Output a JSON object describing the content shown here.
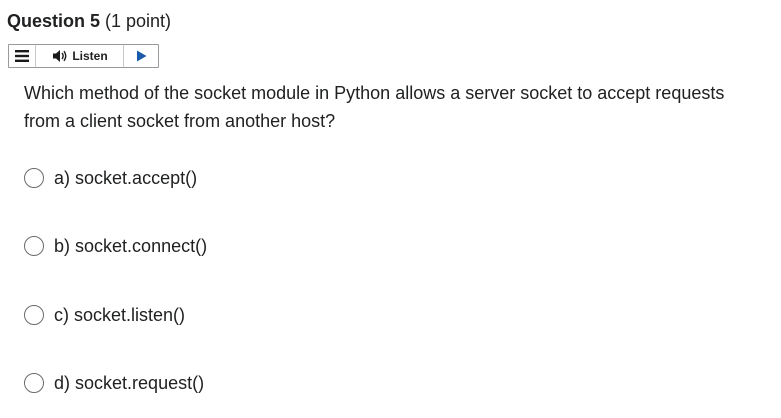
{
  "question": {
    "title": "Question 5",
    "points": " (1 point)",
    "text": "Which method of the socket module in Python allows a server socket to accept requests from a client socket from another host?"
  },
  "toolbar": {
    "menu_icon": "hamburger-menu-icon",
    "listen_icon": "speaker-icon",
    "listen_label": "Listen",
    "play_icon": "play-icon"
  },
  "options": [
    {
      "letter": "a)",
      "text": "socket.accept()",
      "selected": false
    },
    {
      "letter": "b)",
      "text": "socket.connect()",
      "selected": false
    },
    {
      "letter": "c)",
      "text": "socket.listen()",
      "selected": false
    },
    {
      "letter": "d)",
      "text": "socket.request()",
      "selected": false
    }
  ],
  "colors": {
    "text": "#202122",
    "border": "#9a9a9a",
    "radio_border": "#6b6b6b"
  }
}
